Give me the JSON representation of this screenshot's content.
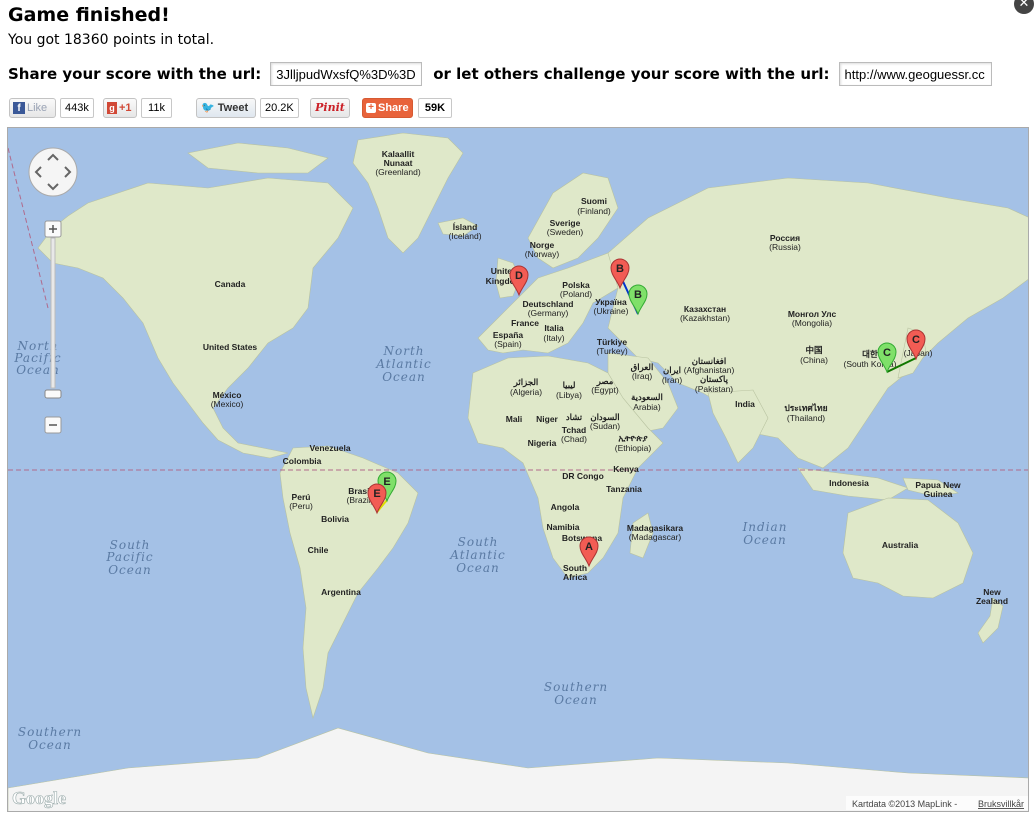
{
  "header": {
    "title": "Game finished!",
    "score_text": "You got 18360 points in total.",
    "share_label": "Share your score with the url:",
    "share_url": "3JlljpudWxsfQ%3D%3D",
    "challenge_label": "or let others challenge your score with the url:",
    "challenge_url": "http://www.geoguessr.cc"
  },
  "social": {
    "like_label": "Like",
    "like_count": "443k",
    "plusone_label": "+1",
    "plusone_count": "11k",
    "tweet_label": "Tweet",
    "tweet_count": "20.2K",
    "pinit_label": "Pinit",
    "share_label": "Share",
    "share_count": "59K"
  },
  "map": {
    "labels": {
      "greenland": "Kalaallit",
      "greenland2": "Nunaat",
      "greenland3": "(Greenland)",
      "finland": "Suomi",
      "finland2": "(Finland)",
      "iceland": "Ísland",
      "iceland2": "(Iceland)",
      "sweden": "Sverige",
      "sweden2": "(Sweden)",
      "norway": "Norge",
      "norway2": "(Norway)",
      "uk": "United",
      "uk2": "Kingdom",
      "russia": "Россия",
      "russia2": "(Russia)",
      "poland": "Polska",
      "poland2": "(Poland)",
      "germany": "Deutschland",
      "germany2": "(Germany)",
      "ukraine": "Україна",
      "ukraine2": "(Ukraine)",
      "kazakhstan": "Казахстан",
      "kazakhstan2": "(Kazakhstan)",
      "mongolia": "Монгол Улс",
      "mongolia2": "(Mongolia)",
      "france": "France",
      "spain": "España",
      "spain2": "(Spain)",
      "italy": "Italia",
      "italy2": "(Italy)",
      "turkey": "Türkiye",
      "turkey2": "(Turkey)",
      "canada": "Canada",
      "usa": "United States",
      "mexico": "México",
      "mexico2": "(Mexico)",
      "china": "中国",
      "china2": "(China)",
      "japan": "(Japan)",
      "skorea": "대한",
      "skorea2": "(South Korea)",
      "afghanistan": "افغانستان",
      "afghanistan2": "(Afghanistan)",
      "iraq": "العراق",
      "iraq2": "(Iraq)",
      "iran": "ایران",
      "iran2": "(Iran)",
      "pakistan": "پاکستان",
      "pakistan2": "(Pakistan)",
      "saudi": "السعودية",
      "saudi2": "Arabia)",
      "india": "India",
      "thailand": "ประเทศไทย",
      "thailand2": "(Thailand)",
      "algeria": "الجزائر",
      "algeria2": "(Algeria)",
      "libya": "ليبيا",
      "libya2": "(Libya)",
      "egypt": "مصر",
      "egypt2": "(Egypt)",
      "mali": "Mali",
      "niger": "Niger",
      "chad": "تشاد",
      "chad2": "Tchad",
      "chad3": "(Chad)",
      "sudan": "السودان",
      "sudan2": "(Sudan)",
      "nigeria": "Nigeria",
      "ethiopia": "ኢትዮጵያ",
      "ethiopia2": "(Ethiopia)",
      "drc": "DR Congo",
      "kenya": "Kenya",
      "tanzania": "Tanzania",
      "angola": "Angola",
      "namibia": "Namibia",
      "botswana": "Botswana",
      "madagascar": "Madagasikara",
      "madagascar2": "(Madagascar)",
      "southafrica": "South",
      "southafrica2": "Africa",
      "indonesia": "Indonesia",
      "png": "Papua New",
      "png2": "Guinea",
      "australia": "Australia",
      "nz": "New",
      "nz2": "Zealand",
      "venezuela": "Venezuela",
      "colombia": "Colombia",
      "peru": "Perú",
      "peru2": "(Peru)",
      "bolivia": "Bolivia",
      "brazil": "Brasil",
      "brazil2": "(Brazil)",
      "chile": "Chile",
      "argentina": "Argentina"
    },
    "oceans": {
      "north_pacific": "North",
      "north_pacific2": "Pacific",
      "north_pacific3": "Ocean",
      "north_atlantic": "North",
      "north_atlantic2": "Atlantic",
      "north_atlantic3": "Ocean",
      "south_pacific": "South",
      "south_pacific2": "Pacific",
      "south_pacific3": "Ocean",
      "south_atlantic": "South",
      "south_atlantic2": "Atlantic",
      "south_atlantic3": "Ocean",
      "indian": "Indian",
      "indian2": "Ocean",
      "southern": "Southern",
      "southern2": "Ocean",
      "southern_w": "Southern",
      "southern_w2": "Ocean"
    },
    "markers": {
      "a": "A",
      "b": "B",
      "c": "C",
      "d": "D",
      "e": "E"
    },
    "guess_color": "#f25c54",
    "actual_color": "#7fe069",
    "logo": "Google",
    "attribution": "Kartdata ©2013 MapLink - ",
    "terms": "Bruksvillkår"
  }
}
